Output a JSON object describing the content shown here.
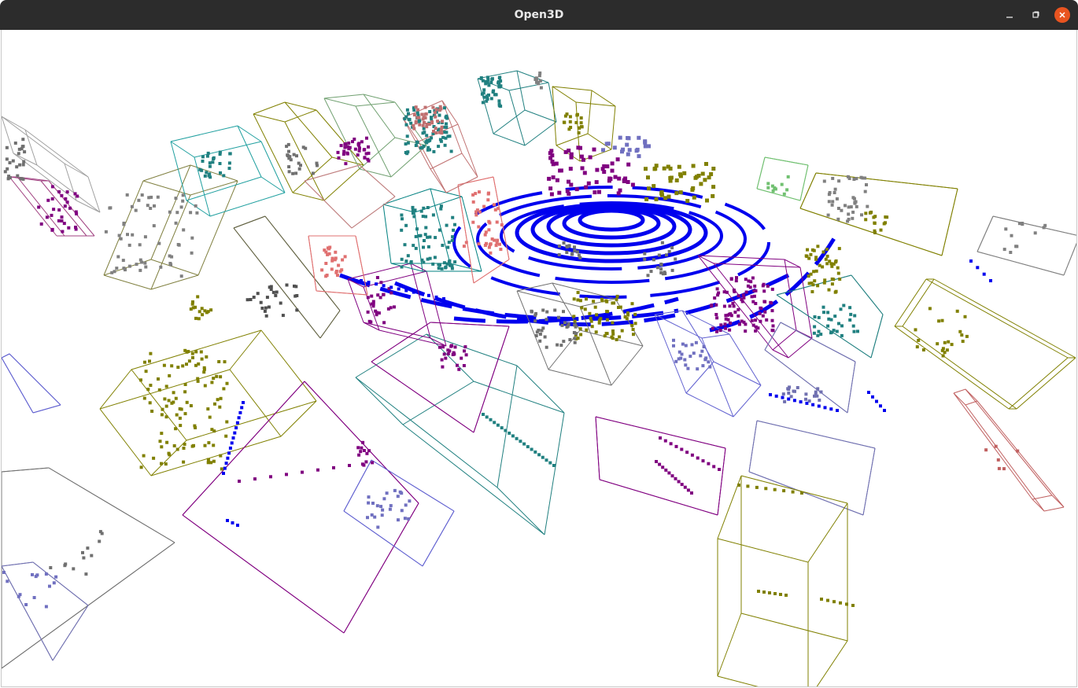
{
  "window": {
    "title": "Open3D",
    "controls": {
      "minimize": "minimize-icon",
      "maximize": "maximize-icon",
      "close": "close-icon"
    },
    "titlebar_color": "#2c2c2c",
    "close_color": "#e95420"
  },
  "scene": {
    "background": "#ffffff",
    "ground_points_color": "#0000ee",
    "palette": [
      "#808000",
      "#800080",
      "#008080",
      "#7a7a7a",
      "#e07a7a",
      "#8080e0",
      "#70d070",
      "#a0a060"
    ]
  }
}
